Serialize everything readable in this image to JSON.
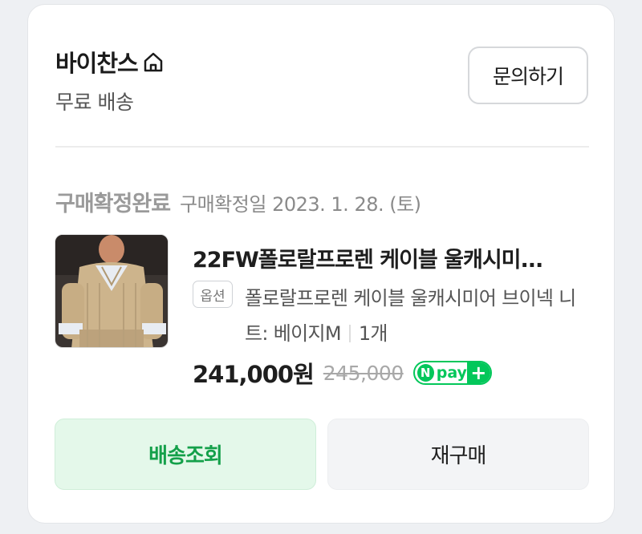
{
  "store": {
    "name": "바이찬스",
    "home_icon": "home-icon",
    "shipping": "무료 배송",
    "inquiry_label": "문의하기"
  },
  "order": {
    "status": "구매확정완료",
    "confirm_date": "구매확정일 2023. 1. 28. (토)"
  },
  "product": {
    "title": "22FW폴로랄프로렌 케이블 울캐시미...",
    "option_badge": "옵션",
    "option_text": "폴로랄프로렌 케이블 울캐시미어 브이넥 니트: 베이지M",
    "quantity": "1개",
    "price": "241,000원",
    "original_price": "245,000",
    "npay": {
      "n": "N",
      "text": "pay",
      "plus": "+",
      "color": "#03c75a"
    }
  },
  "actions": {
    "track_label": "배송조회",
    "rebuy_label": "재구매"
  },
  "colors": {
    "accent_green": "#14a04a",
    "track_bg": "#e4f8ea",
    "rebuy_bg": "#f3f4f6"
  }
}
